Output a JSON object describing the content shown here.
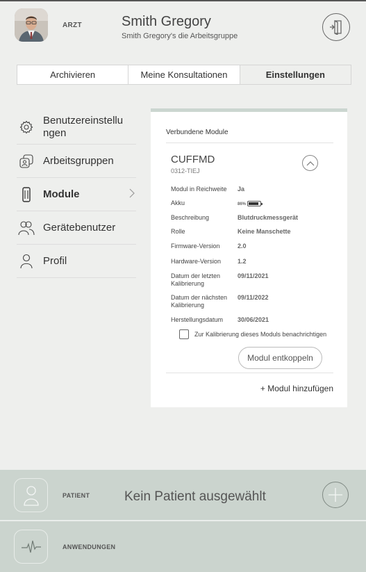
{
  "header": {
    "role": "ARZT",
    "user_name": "Smith Gregory",
    "group": "Smith Gregory's die Arbeitsgruppe"
  },
  "tabs": [
    {
      "label": "Archivieren",
      "active": false
    },
    {
      "label": "Meine Konsultationen",
      "active": false
    },
    {
      "label": "Einstellungen",
      "active": true
    }
  ],
  "sidebar": {
    "items": [
      {
        "label": "Benutzereinstellu ngen",
        "icon": "gear-icon"
      },
      {
        "label": "Arbeitsgruppen",
        "icon": "groups-icon"
      },
      {
        "label": "Module",
        "icon": "module-icon",
        "active": true
      },
      {
        "label": "Gerätebenutzer",
        "icon": "users-icon"
      },
      {
        "label": "Profil",
        "icon": "profile-icon"
      }
    ]
  },
  "card": {
    "title": "Verbundene Module",
    "module": {
      "name": "CUFFMD",
      "id": "0312-TIEJ",
      "details": [
        {
          "label": "Modul in Reichweite",
          "value": "Ja"
        },
        {
          "label": "Akku",
          "value": "86%",
          "battery_level": 0.86
        },
        {
          "label": "Beschreibung",
          "value": "Blutdruckmessgerät"
        },
        {
          "label": "Rolle",
          "value": "Keine Manschette"
        },
        {
          "label": "Firmware-Version",
          "value": "2.0"
        },
        {
          "label": "Hardware-Version",
          "value": "1.2"
        },
        {
          "label": "Datum der letzten Kalibrierung",
          "value": "09/11/2021"
        },
        {
          "label": "Datum der nächsten Kalibrierung",
          "value": "09/11/2022"
        },
        {
          "label": "Herstellungsdatum",
          "value": "30/06/2021"
        }
      ],
      "notify_label": "Zur Kalibrierung dieses Moduls benachrichtigen",
      "unpair_label": "Modul entkoppeln"
    },
    "add_module_label": "+ Modul hinzufügen"
  },
  "patient_panel": {
    "label": "PATIENT",
    "title": "Kein Patient ausgewählt"
  },
  "apps_panel": {
    "label": "ANWENDUNGEN"
  },
  "colors": {
    "background": "#eeefed",
    "panel": "#cbd4ce",
    "card_accent": "#cbd6d0"
  }
}
